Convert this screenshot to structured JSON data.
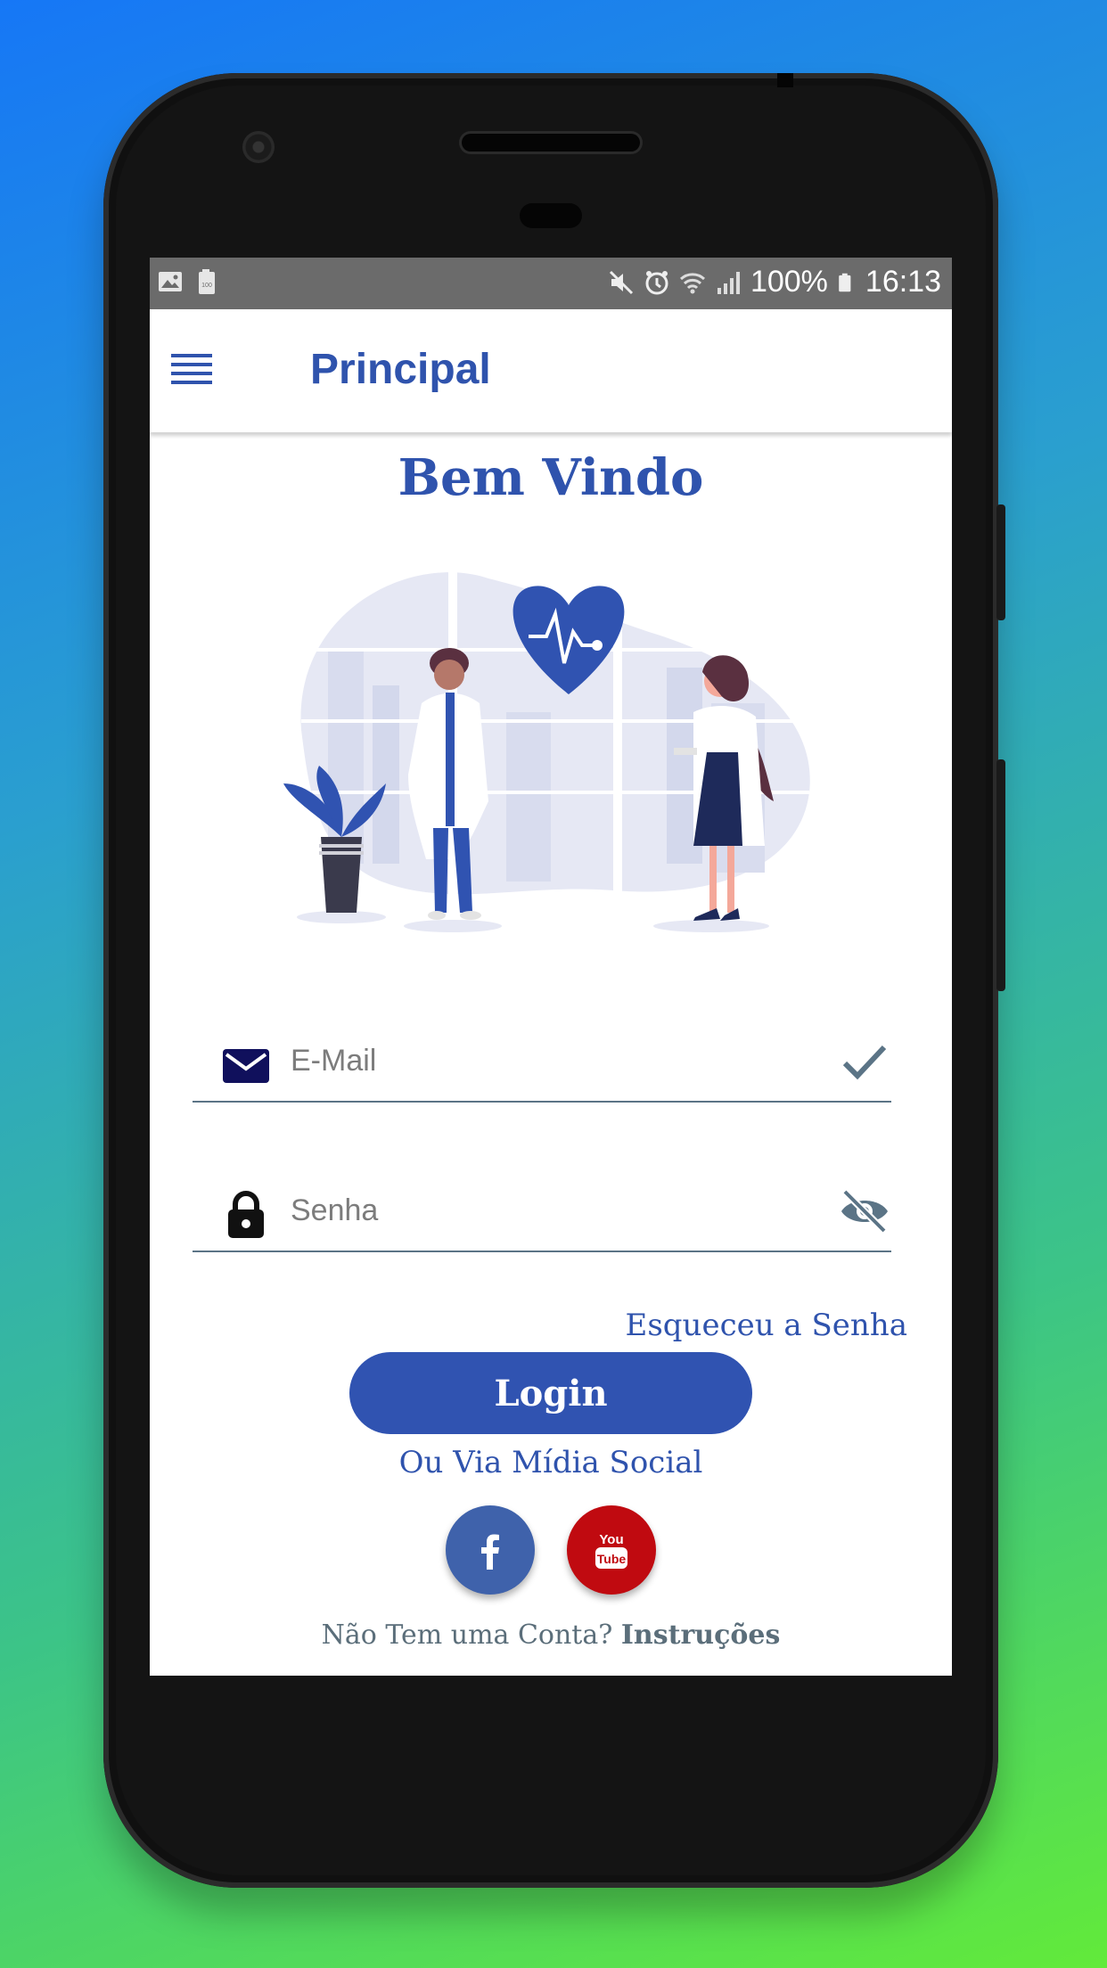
{
  "statusbar": {
    "battery": "100%",
    "time": "16:13",
    "battery_badge": "100"
  },
  "appbar": {
    "title": "Principal"
  },
  "main": {
    "welcome": "Bem Vindo",
    "email_placeholder": "E-Mail",
    "password_placeholder": "Senha",
    "forgot_label": "Esqueceu a Senha",
    "login_label": "Login",
    "social_label": "Ou Via Mídia Social",
    "no_account_text": "Não Tem uma Conta?",
    "instructions_link": "Instruções",
    "youtube_text_top": "You",
    "youtube_text_bottom": "Tube"
  },
  "colors": {
    "brand": "#2f53ad",
    "facebook": "#3f62ab",
    "youtube": "#c00a10",
    "statusbar": "#6b6b6b"
  },
  "icons": [
    "menu-icon",
    "mail-icon",
    "check-icon",
    "lock-icon",
    "eye-off-icon",
    "facebook-icon",
    "youtube-icon"
  ]
}
